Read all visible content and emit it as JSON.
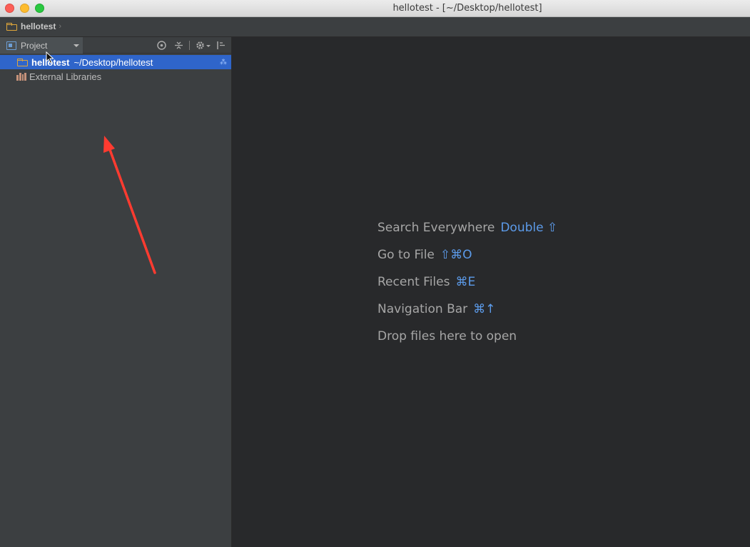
{
  "window": {
    "title": "hellotest - [~/Desktop/hellotest]"
  },
  "breadcrumb": {
    "project": "hellotest",
    "separator": "›"
  },
  "project_panel": {
    "view_label": "Project",
    "tree": [
      {
        "name": "hellotest",
        "path": "~/Desktop/hellotest",
        "selected": true
      },
      {
        "name": "External Libraries"
      }
    ]
  },
  "editor": {
    "hints": [
      {
        "text": "Search Everywhere",
        "shortcut": "Double ⇧"
      },
      {
        "text": "Go to File",
        "shortcut": "⇧⌘O"
      },
      {
        "text": "Recent Files",
        "shortcut": "⌘E"
      },
      {
        "text": "Navigation Bar",
        "shortcut": "⌘↑"
      },
      {
        "text": "Drop files here to open"
      }
    ]
  },
  "colors": {
    "selection": "#2f65ca",
    "shortcut": "#5c9bea",
    "annotation": "#ff3b30"
  }
}
